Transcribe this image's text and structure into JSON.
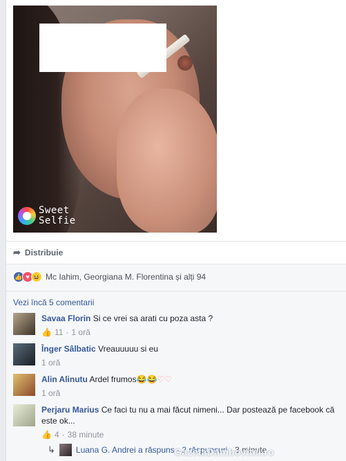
{
  "photo": {
    "app_badge_line1": "Sweet",
    "app_badge_line2": "Selfie"
  },
  "actions": {
    "share_label": "Distribuie",
    "share_icon": "share-arrow-icon"
  },
  "reactions": {
    "icons": [
      "like-icon",
      "love-icon",
      "haha-icon"
    ],
    "summary": "Mc Iahim, Georgiana M. Florentina și alți 94"
  },
  "comments_section": {
    "more_label": "Vezi încă 5 comentarii",
    "comments": [
      {
        "name": "Savaa Florin",
        "text": "Si ce vrei sa arati cu poza asta ?",
        "likes": "11",
        "time": "1 oră"
      },
      {
        "name": "Înger Sâlbatic",
        "text": "Vreauuuuu si eu",
        "likes": "",
        "time": "1 oră"
      },
      {
        "name": "Alin Alinutu",
        "text": "Ardel frumos",
        "emoji": "😂😂♡♡",
        "likes": "",
        "time": "1 oră"
      },
      {
        "name": "Perjaru Marius",
        "text": "Ce faci tu nu a mai făcut nimeni... Dar postează pe facebook că este ok...",
        "likes": "4",
        "time": "38 minute"
      }
    ],
    "replies": {
      "author": "Luana G. Andrei a răspuns",
      "count": "2 răspunsuri",
      "time": "3 minute"
    }
  },
  "watermark": "GazetaDambovitei.ro"
}
